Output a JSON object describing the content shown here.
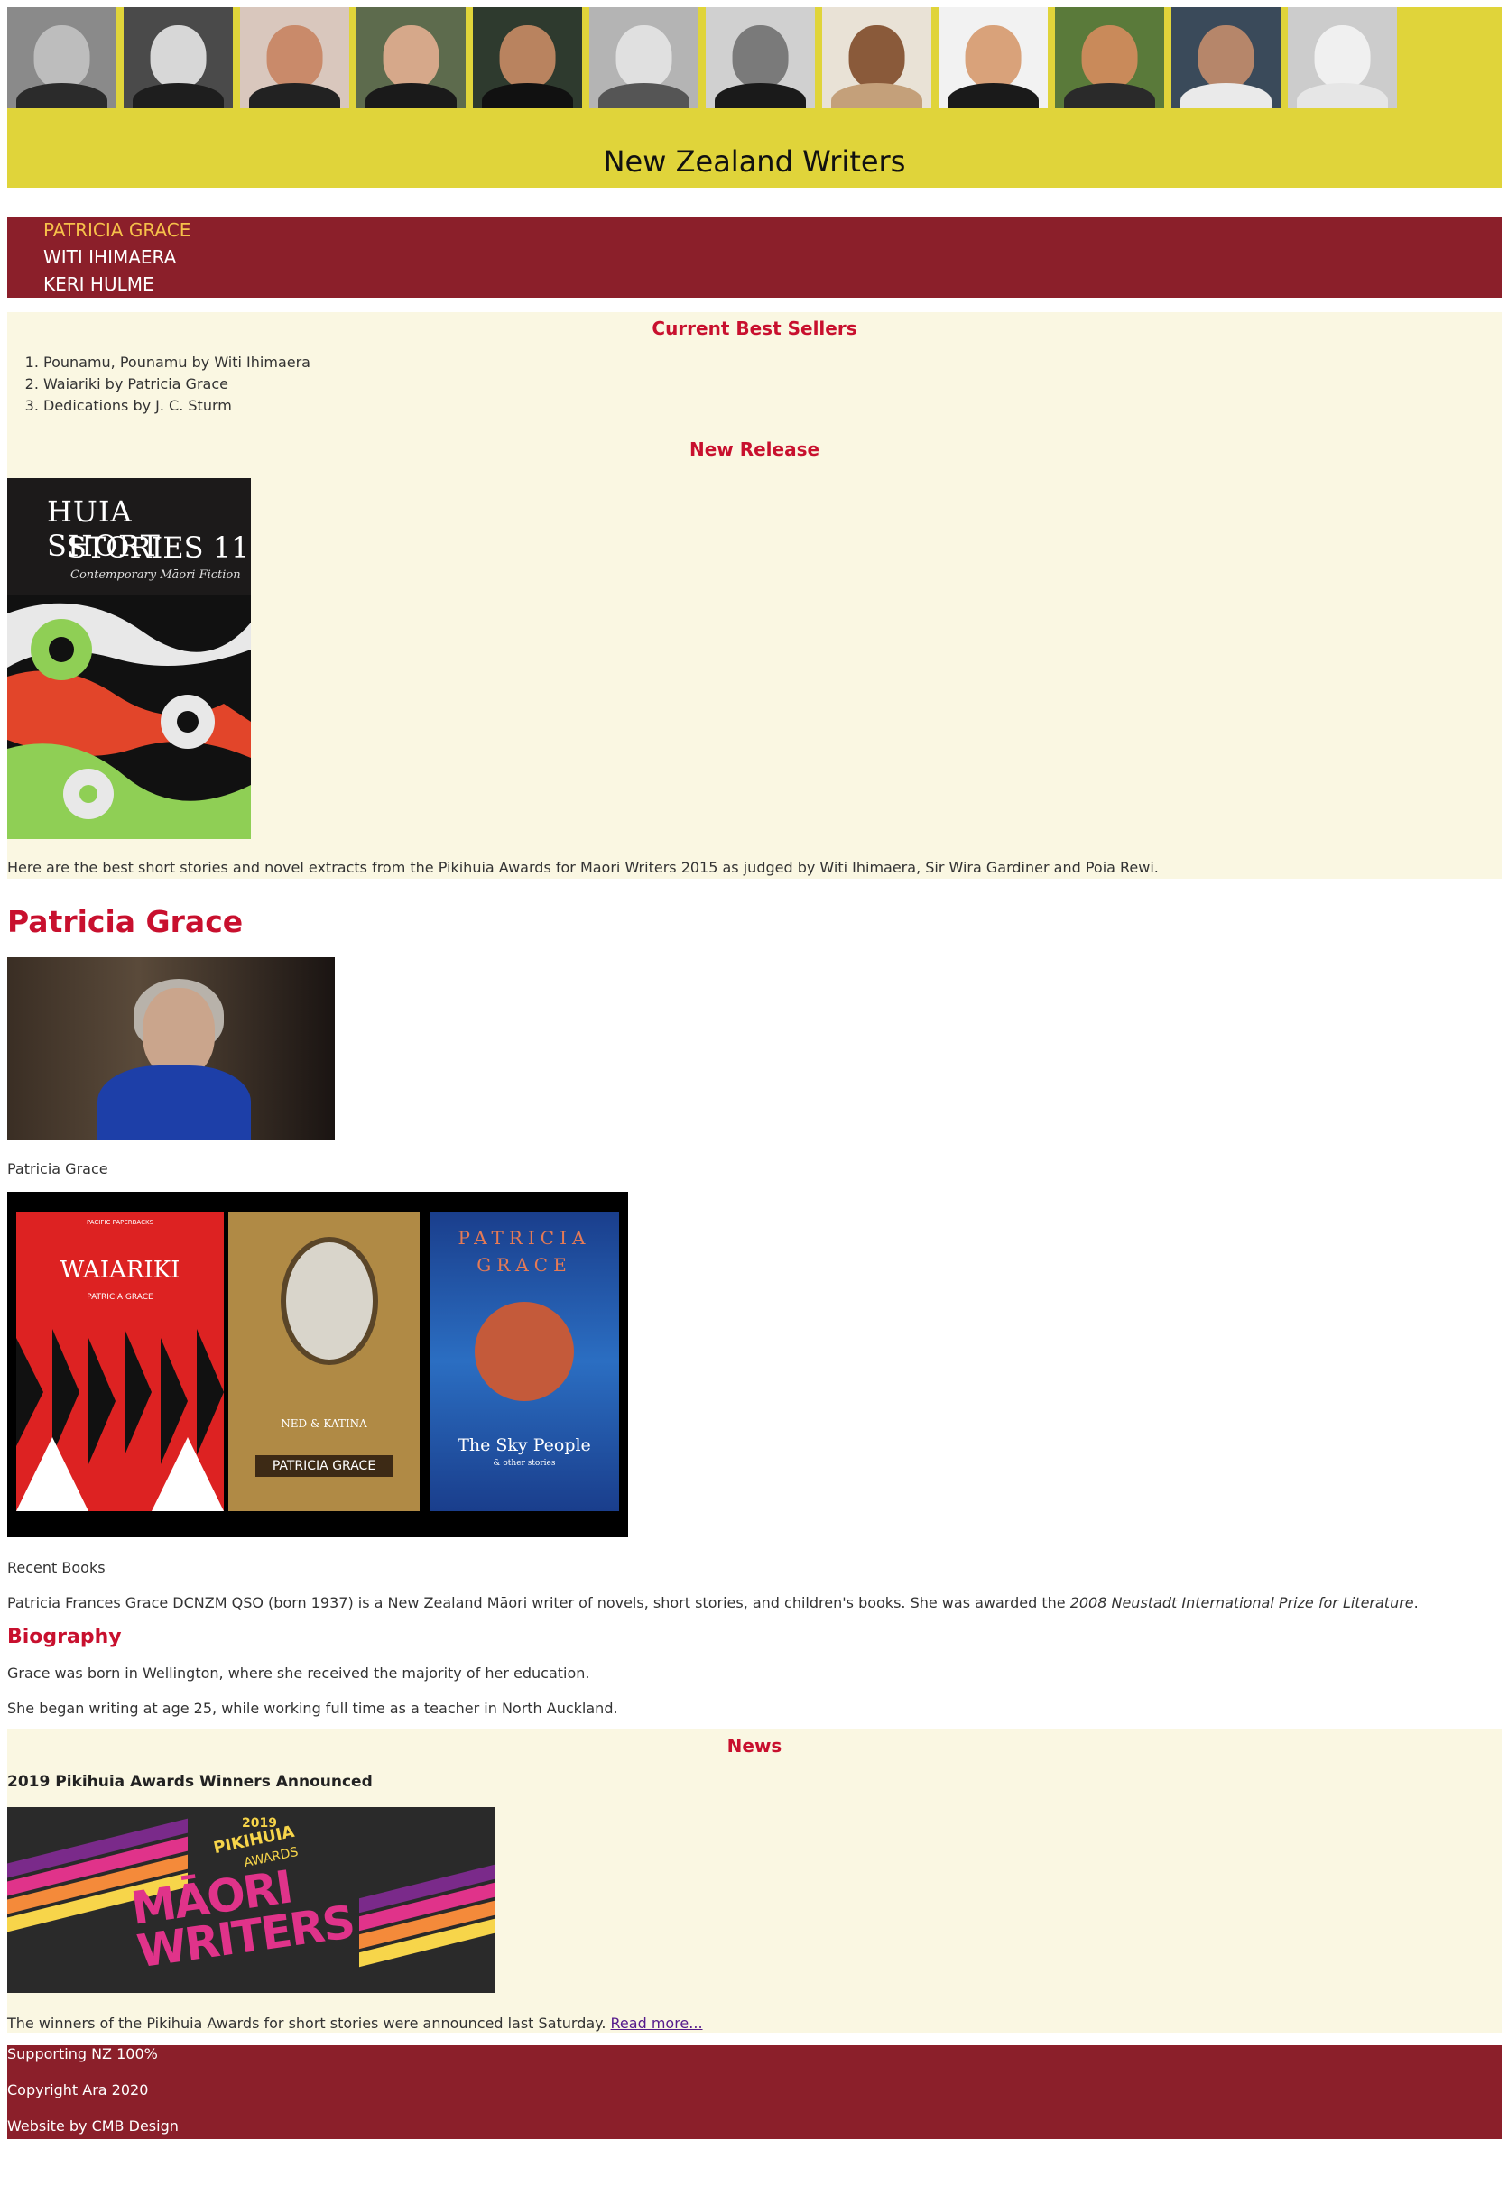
{
  "site": {
    "title": "New Zealand Writers"
  },
  "header": {
    "portraits": [
      {
        "name": "portrait-1",
        "bg": "#8a8a8a",
        "face": "#bdbdbd",
        "shoulders": "#2b2b2b"
      },
      {
        "name": "portrait-2",
        "bg": "#4a4a4a",
        "face": "#d7d7d7",
        "shoulders": "#1e1e1e"
      },
      {
        "name": "portrait-3",
        "bg": "#d9c7bd",
        "face": "#c98a6a",
        "shoulders": "#222222"
      },
      {
        "name": "portrait-4",
        "bg": "#5d6b4d",
        "face": "#d6a88a",
        "shoulders": "#1a1a1a"
      },
      {
        "name": "portrait-5",
        "bg": "#2e3a2e",
        "face": "#b9835f",
        "shoulders": "#111111"
      },
      {
        "name": "portrait-6",
        "bg": "#b4b4b4",
        "face": "#e0e0e0",
        "shoulders": "#555555"
      },
      {
        "name": "portrait-7",
        "bg": "#d0d0d0",
        "face": "#7a7a7a",
        "shoulders": "#1a1a1a"
      },
      {
        "name": "portrait-8",
        "bg": "#e9e2d6",
        "face": "#8a5a3a",
        "shoulders": "#c4a07a"
      },
      {
        "name": "portrait-9",
        "bg": "#f2f2f2",
        "face": "#d9a27a",
        "shoulders": "#1a1a1a"
      },
      {
        "name": "portrait-10",
        "bg": "#5a7a3a",
        "face": "#c98a5a",
        "shoulders": "#2a2a2a"
      },
      {
        "name": "portrait-11",
        "bg": "#3a4a5a",
        "face": "#b6866a",
        "shoulders": "#eaeaea"
      },
      {
        "name": "portrait-12",
        "bg": "#cccccc",
        "face": "#f0f0f0",
        "shoulders": "#e6e6e6"
      }
    ]
  },
  "nav": {
    "items": [
      {
        "label": "PATRICIA GRACE"
      },
      {
        "label": "WITI IHIMAERA"
      },
      {
        "label": "KERI HULME"
      }
    ]
  },
  "best_sellers": {
    "heading": "Current Best Sellers",
    "items": [
      "Pounamu, Pounamu by Witi Ihimaera",
      "Waiariki by Patricia Grace",
      "Dedications by J. C. Sturm"
    ]
  },
  "new_release": {
    "heading": "New Release",
    "cover_title_line1": "HUIA SHORT",
    "cover_title_line2": "STORIES 11",
    "cover_subtitle": "Contemporary Māori Fiction",
    "text": "Here are the best short stories and novel extracts from the Pikihuia Awards for Maori Writers 2015 as judged by Witi Ihimaera, Sir Wira Gardiner and Poia Rewi."
  },
  "author": {
    "name": "Patricia Grace",
    "photo_caption": "Patricia Grace",
    "books_caption": "Recent Books",
    "books": {
      "waiariki_series": "PACIFIC PAPERBACKS",
      "waiariki_title": "WAIARIKI",
      "waiariki_author": "PATRICIA GRACE",
      "ned_title": "NED & KATINA",
      "ned_author": "PATRICIA GRACE",
      "sky_author_line1": "PATRICIA",
      "sky_author_line2": "GRACE",
      "sky_title": "The Sky People",
      "sky_subtitle": "& other stories"
    },
    "intro_plain": "Patricia Frances Grace DCNZM QSO (born 1937) is a New Zealand Māori writer of novels, short stories, and children's books. She was awarded the ",
    "intro_italic": "2008 Neustadt International Prize for Literature",
    "intro_end": ".",
    "biography_heading": "Biography",
    "bio_p1": "Grace was born in Wellington, where she received the majority of her education.",
    "bio_p2": "She began writing at age 25, while working full time as a teacher in North Auckland."
  },
  "news": {
    "heading": "News",
    "title": "2019 Pikihuia Awards Winners Announced",
    "banner_year": "2019",
    "banner_line1": "PIKIHUIA",
    "banner_line2": "AWARDS",
    "banner_line3": "MĀORI",
    "banner_line4": "WRITERS",
    "text": "The winners of the Pikihuia Awards for short stories were announced last Saturday. ",
    "read_more": "Read more..."
  },
  "footer": {
    "line1": "Supporting NZ 100%",
    "line2": "Copyright Ara 2020",
    "line3": "Website by CMB Design"
  },
  "colors": {
    "header_bg": "#e0d43a",
    "nav_bg": "#8b1f2a",
    "nav_active": "#f6c04a",
    "panel_bg": "#faf7e2",
    "heading_red": "#c8102e",
    "footer_bg": "#8b1f2a"
  }
}
